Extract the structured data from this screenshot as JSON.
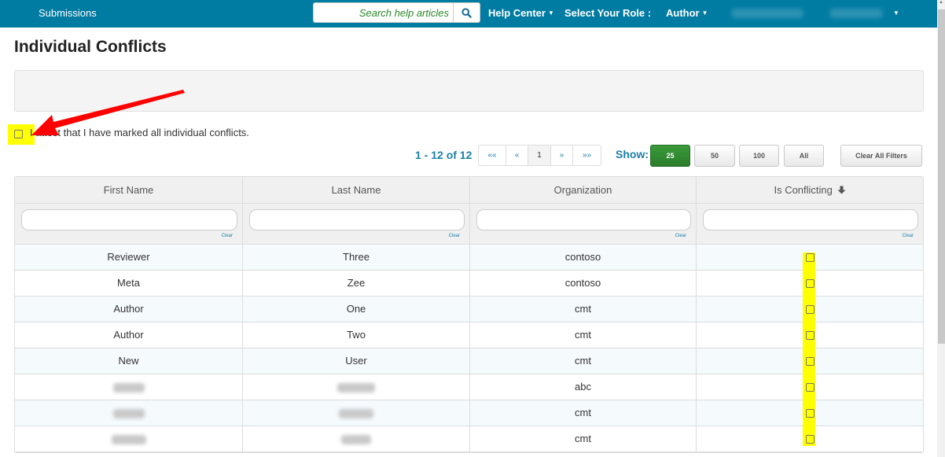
{
  "nav": {
    "submissions": "Submissions",
    "search_placeholder": "Search help articles",
    "search_icon": "search-icon",
    "help_center": "Help Center",
    "role_label": "Select Your Role :",
    "role_value": "Author"
  },
  "page": {
    "title": "Individual Conflicts",
    "attest_label": "I attest that I have marked all individual conflicts."
  },
  "paging": {
    "count_text": "1 - 12 of 12",
    "first": "««",
    "prev": "«",
    "current": "1",
    "next": "»",
    "last": "»»",
    "show_label": "Show:",
    "sizes": [
      "25",
      "50",
      "100",
      "All"
    ],
    "active_size": "25",
    "clear_all": "Clear All Filters"
  },
  "table": {
    "columns": [
      "First Name",
      "Last Name",
      "Organization",
      "Is Conflicting"
    ],
    "sort_column": "Is Conflicting",
    "sort_icon": "arrow-down-icon",
    "filter_clear": "Clear",
    "rows": [
      {
        "first": "Reviewer",
        "last": "Three",
        "org": "contoso",
        "conflicting": false
      },
      {
        "first": "Meta",
        "last": "Zee",
        "org": "contoso",
        "conflicting": false
      },
      {
        "first": "Author",
        "last": "One",
        "org": "cmt",
        "conflicting": false
      },
      {
        "first": "Author",
        "last": "Two",
        "org": "cmt",
        "conflicting": false
      },
      {
        "first": "New",
        "last": "User",
        "org": "cmt",
        "conflicting": false
      },
      {
        "first": "",
        "last": "",
        "org": "abc",
        "conflicting": false,
        "redacted": true
      },
      {
        "first": "",
        "last": "",
        "org": "cmt",
        "conflicting": false,
        "redacted": true
      },
      {
        "first": "",
        "last": "",
        "org": "cmt",
        "conflicting": false,
        "redacted": true
      }
    ]
  },
  "colors": {
    "nav_bg": "#007ca3",
    "accent_blue": "#1a7fa8",
    "active_green": "#2e8b2e",
    "highlight_yellow": "#ffff00",
    "annotation_red": "#ff0000"
  }
}
